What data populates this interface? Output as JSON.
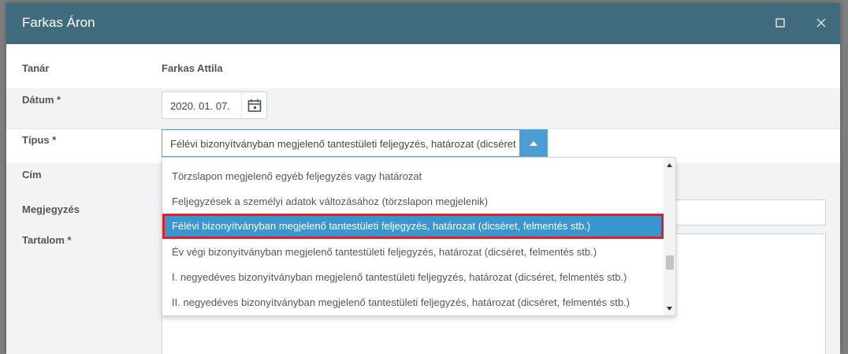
{
  "dialog": {
    "title": "Farkas Áron"
  },
  "form": {
    "teacher_label": "Tanár",
    "teacher_value": "Farkas Attila",
    "date_label": "Dátum *",
    "date_value": "2020. 01. 07.",
    "type_label": "Típus *",
    "type_selected": "Félévi bizonyítványban megjelenő tantestületi feljegyzés, határozat (dicséret, felmentés stb.)",
    "title_label": "Cím",
    "note_label": "Megjegyzés",
    "content_label": "Tartalom *"
  },
  "dropdown": {
    "options": [
      "Törzslapon megjelenő egyéb feljegyzés vagy határozat",
      "Feljegyzések a személyi adatok változásához (törzslapon megjelenik)",
      "Félévi bizonyítványban megjelenő tantestületi feljegyzés, határozat (dicséret, felmentés stb.)",
      "Év végi bizonyítványban megjelenő tantestületi feljegyzés, határozat (dicséret, felmentés stb.)",
      "I. negyedéves bizonyítványban megjelenő tantestületi feljegyzés, határozat (dicséret, felmentés stb.)",
      "II. negyedéves bizonyítványban megjelenő tantestületi feljegyzés, határozat (dicséret, felmentés stb.)"
    ],
    "selected_index": 2
  },
  "colors": {
    "titlebar": "#3f6b7c",
    "accent": "#3a96cf",
    "highlight_border": "#e0202a"
  }
}
